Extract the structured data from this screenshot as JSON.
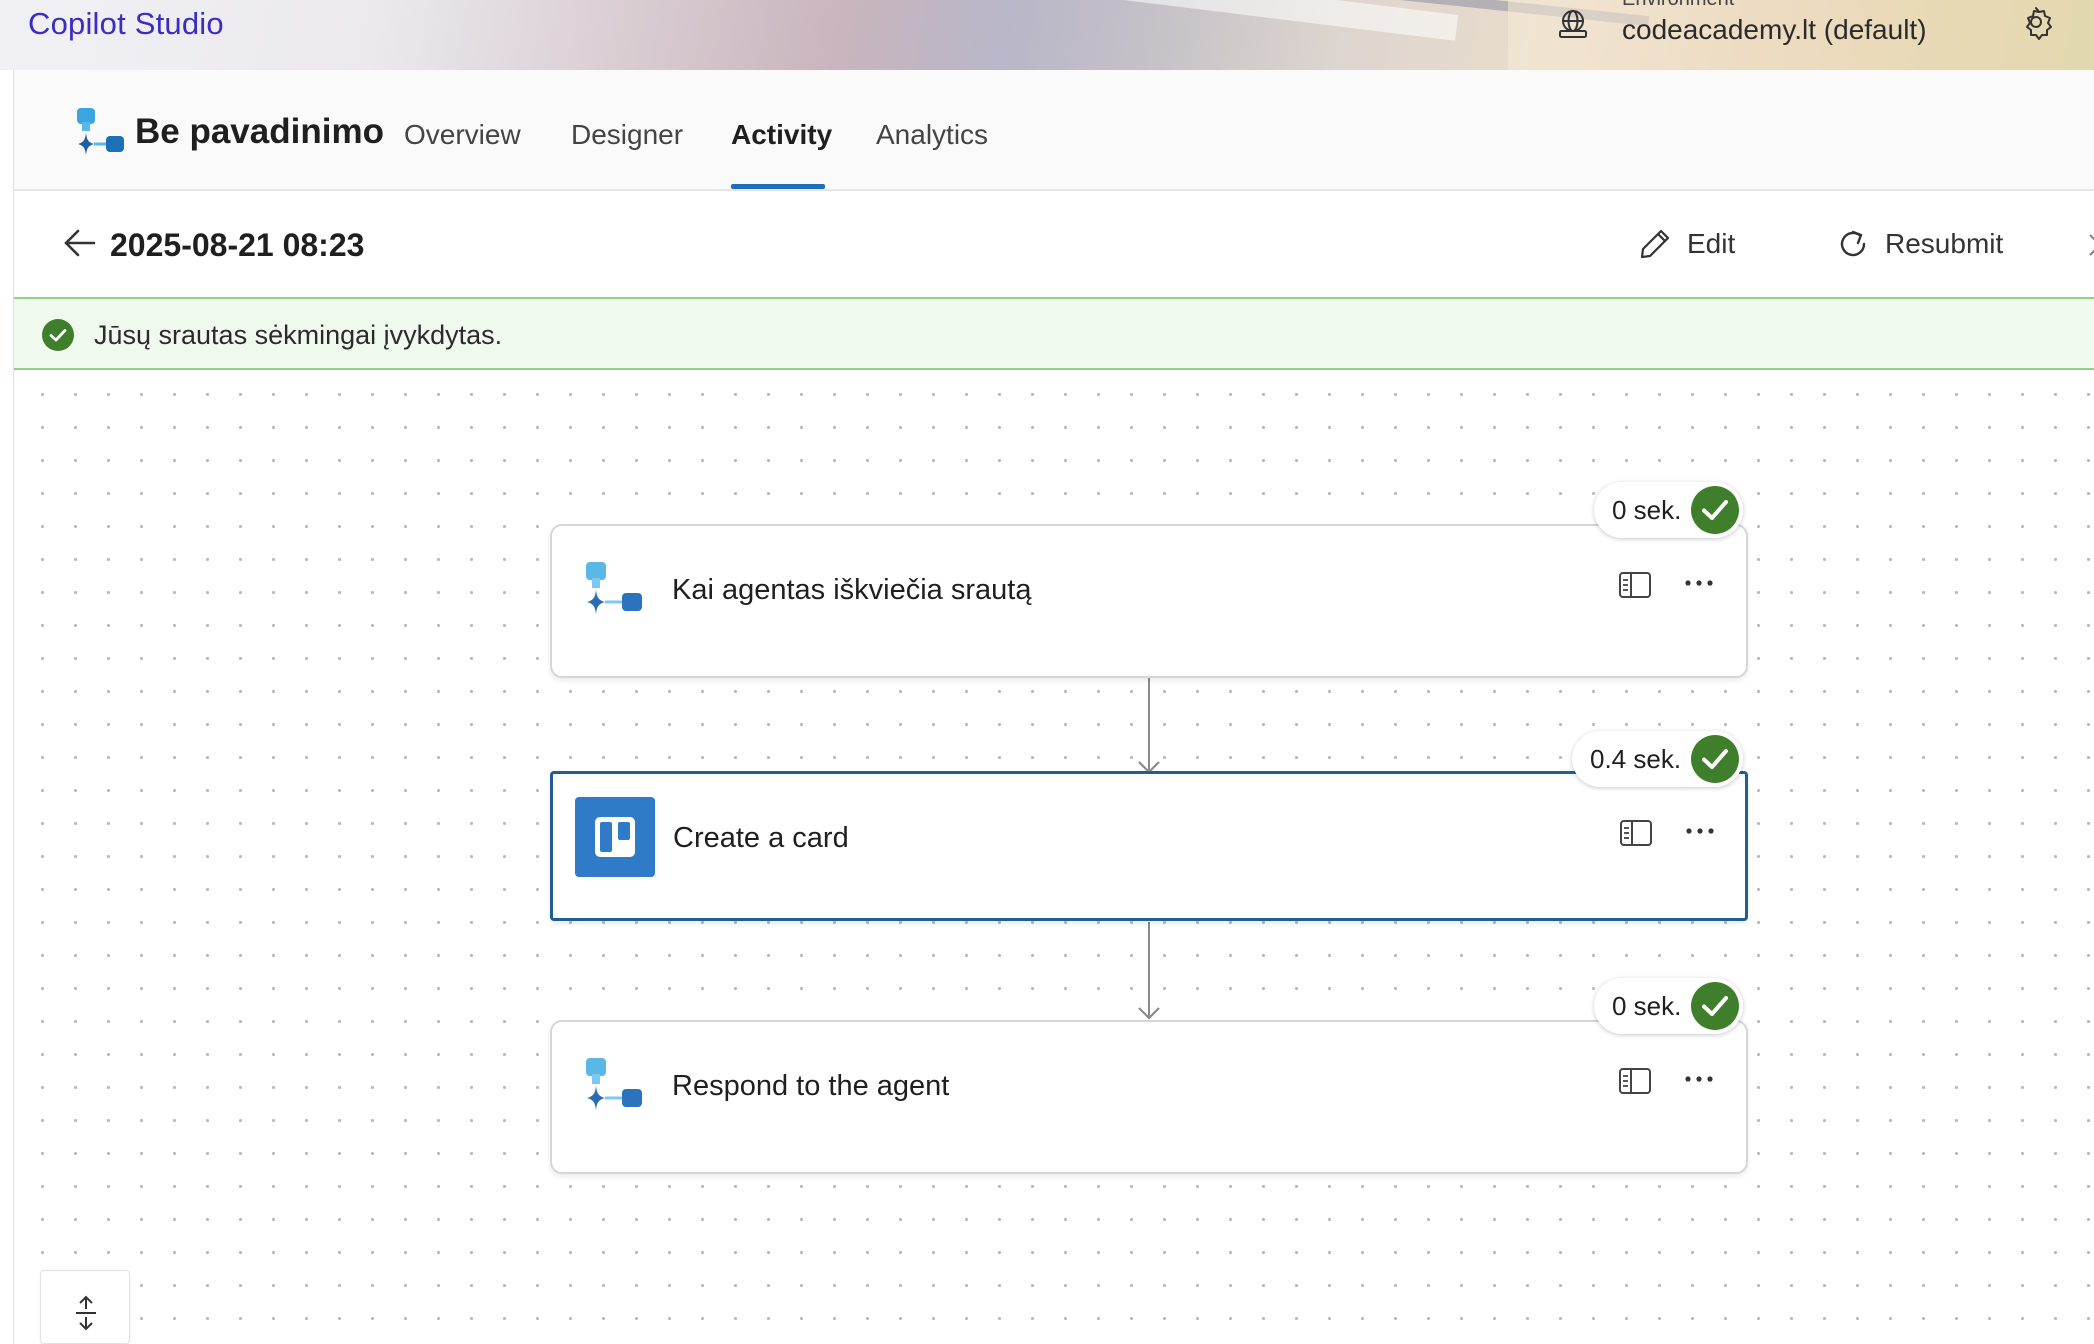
{
  "app": {
    "brand": "Copilot Studio",
    "environment_label": "Environment",
    "environment_value": "codeacademy.lt (default)"
  },
  "flow": {
    "name": "Be pavadinimo",
    "tabs": [
      {
        "label": "Overview",
        "active": false
      },
      {
        "label": "Designer",
        "active": false
      },
      {
        "label": "Activity",
        "active": true
      },
      {
        "label": "Analytics",
        "active": false
      }
    ]
  },
  "run": {
    "title": "2025-08-21 08:23",
    "edit_label": "Edit",
    "resubmit_label": "Resubmit",
    "status_message": "Jūsų srautas sėkmingai įvykdytas."
  },
  "steps": [
    {
      "label": "Kai agentas iškviečia srautą",
      "duration": "0 sek.",
      "icon": "copilot-flow-icon",
      "status": "succeeded"
    },
    {
      "label": "Create a card",
      "duration": "0.4 sek.",
      "icon": "trello-icon",
      "status": "succeeded"
    },
    {
      "label": "Respond to the agent",
      "duration": "0 sek.",
      "icon": "copilot-flow-icon",
      "status": "succeeded"
    }
  ],
  "colors": {
    "brand": "#3b2cc4",
    "accent": "#1e6fb8",
    "success": "#3f7e2b",
    "trello": "#2f7bc7"
  }
}
